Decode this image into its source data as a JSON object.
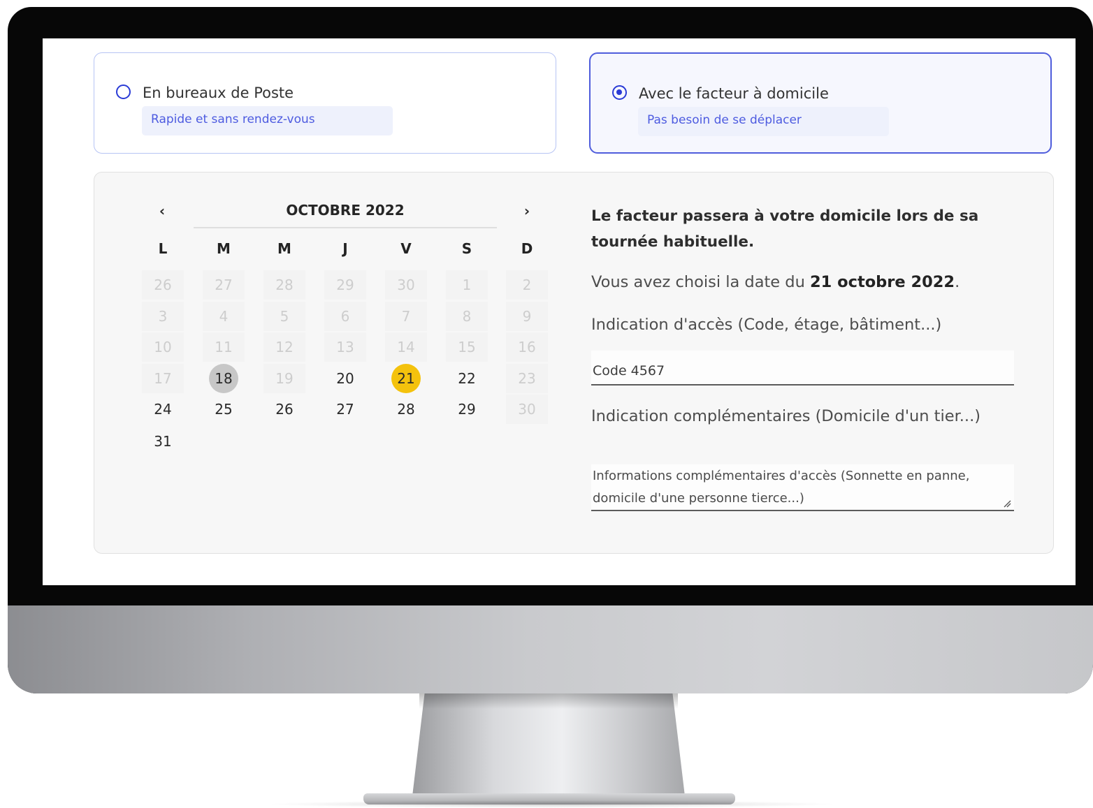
{
  "delivery_options": [
    {
      "title": "En bureaux de Poste",
      "subtitle": "Rapide et sans rendez-vous",
      "selected": false
    },
    {
      "title": "Avec le facteur à domicile",
      "subtitle": "Pas besoin de se déplacer",
      "selected": true
    }
  ],
  "calendar": {
    "month_label": "OCTOBRE 2022",
    "prev_icon": "chevron-left-icon",
    "next_icon": "chevron-right-icon",
    "weekdays": [
      "L",
      "M",
      "M",
      "J",
      "V",
      "S",
      "D"
    ],
    "weeks": [
      [
        {
          "d": "26",
          "muted": true
        },
        {
          "d": "27",
          "muted": true
        },
        {
          "d": "28",
          "muted": true
        },
        {
          "d": "29",
          "muted": true
        },
        {
          "d": "30",
          "muted": true
        },
        {
          "d": "1",
          "muted": true
        },
        {
          "d": "2",
          "muted": true
        }
      ],
      [
        {
          "d": "3",
          "muted": true
        },
        {
          "d": "4",
          "muted": true
        },
        {
          "d": "5",
          "muted": true
        },
        {
          "d": "6",
          "muted": true
        },
        {
          "d": "7",
          "muted": true
        },
        {
          "d": "8",
          "muted": true
        },
        {
          "d": "9",
          "muted": true
        }
      ],
      [
        {
          "d": "10",
          "muted": true
        },
        {
          "d": "11",
          "muted": true
        },
        {
          "d": "12",
          "muted": true
        },
        {
          "d": "13",
          "muted": true
        },
        {
          "d": "14",
          "muted": true
        },
        {
          "d": "15",
          "muted": true
        },
        {
          "d": "16",
          "muted": true
        }
      ],
      [
        {
          "d": "17",
          "muted": true
        },
        {
          "d": "18",
          "today": true
        },
        {
          "d": "19",
          "muted": true
        },
        {
          "d": "20"
        },
        {
          "d": "21",
          "selected": true
        },
        {
          "d": "22"
        },
        {
          "d": "23",
          "muted": true
        }
      ],
      [
        {
          "d": "24"
        },
        {
          "d": "25"
        },
        {
          "d": "26"
        },
        {
          "d": "27"
        },
        {
          "d": "28"
        },
        {
          "d": "29"
        },
        {
          "d": "30",
          "muted": true
        }
      ],
      [
        {
          "d": "31"
        }
      ]
    ],
    "today_color": "#c7c7c7",
    "selected_color": "#f4c20d"
  },
  "form": {
    "heading": "Le facteur passera à votre domicile lors de sa tournée habituelle.",
    "chosen_prefix": "Vous avez choisi la date du ",
    "chosen_date": "21 octobre 2022",
    "chosen_suffix": ".",
    "access_label": "Indication d'accès (Code, étage, bâtiment...)",
    "access_value": "Code 4567",
    "extra_label": "Indication complémentaires (Domicile d'un tier...)",
    "extra_placeholder": "Informations complémentaires d'accès (Sonnette en panne, domicile d'une personne tierce...)"
  },
  "colors": {
    "accent": "#2a3bd6",
    "option_subtitle": "#4d5be0",
    "monitor_frame": "#070707"
  }
}
